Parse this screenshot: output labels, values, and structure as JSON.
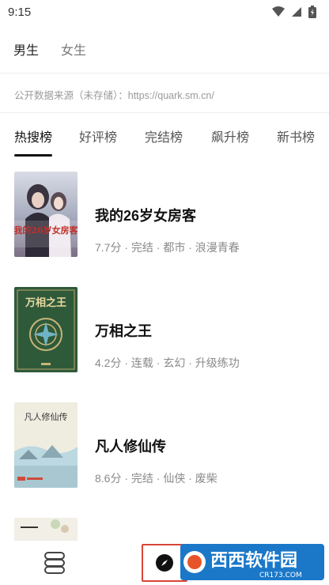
{
  "status_bar": {
    "time": "9:15"
  },
  "gender_tabs": [
    {
      "label": "男生",
      "active": true
    },
    {
      "label": "女生",
      "active": false
    }
  ],
  "source_note": "公开数据来源（未存储）：https://quark.sm.cn/",
  "rank_tabs": [
    {
      "label": "热搜榜",
      "active": true
    },
    {
      "label": "好评榜",
      "active": false
    },
    {
      "label": "完结榜",
      "active": false
    },
    {
      "label": "飙升榜",
      "active": false
    },
    {
      "label": "新书榜",
      "active": false
    }
  ],
  "books": [
    {
      "title": "我的26岁女房客",
      "meta": "7.7分 · 完结 · 都市 · 浪漫青春",
      "cover_text": "我的26岁女房客"
    },
    {
      "title": "万相之王",
      "meta": "4.2分 · 连载 · 玄幻 · 升级练功",
      "cover_text": "万相之王"
    },
    {
      "title": "凡人修仙传",
      "meta": "8.6分 · 完结 · 仙侠 · 废柴",
      "cover_text": "凡人修仙传"
    },
    {
      "title": "",
      "meta": "",
      "cover_text": ""
    }
  ],
  "bottom_nav": {
    "shelf_icon": "bookshelf-icon",
    "discover_icon": "compass-icon",
    "highlight_color": "#d9453a"
  },
  "watermark": {
    "text": "西西软件园",
    "url": "CR173.COM"
  }
}
